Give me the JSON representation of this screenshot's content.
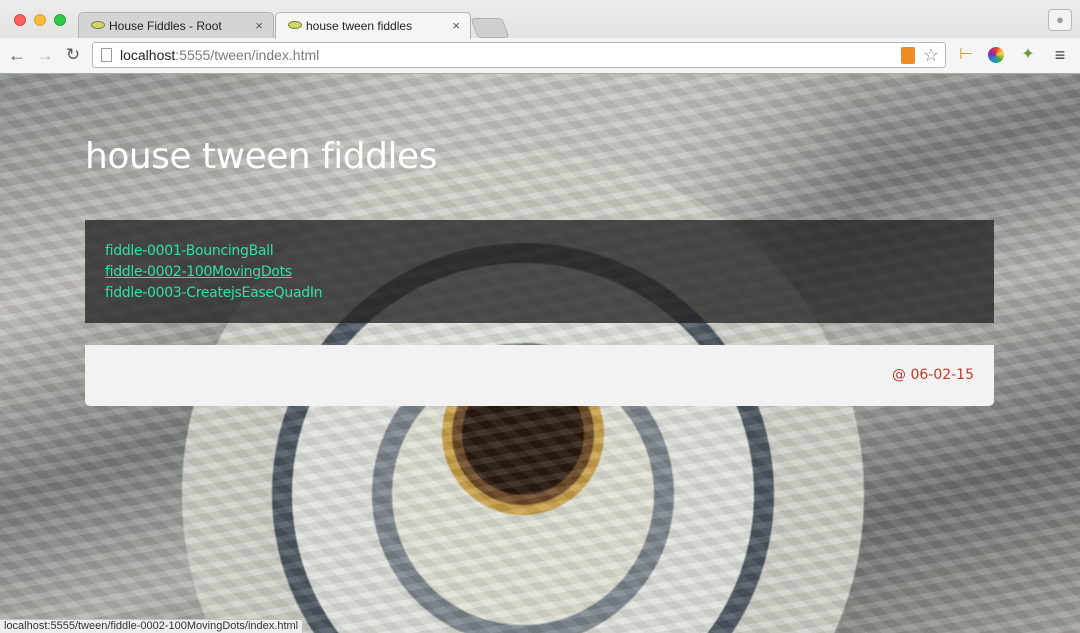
{
  "browser": {
    "tabs": [
      {
        "title": "House Fiddles - Root",
        "close": "×"
      },
      {
        "title": "house tween fiddles",
        "close": "×"
      }
    ],
    "user_icon": "person-icon",
    "nav": {
      "back": "←",
      "forward": "→",
      "reload": "↻"
    },
    "url_host": "localhost",
    "url_path": ":5555/tween/index.html",
    "star": "☆",
    "menu": "≡",
    "status_url": "localhost:5555/tween/fiddle-0002-100MovingDots/index.html"
  },
  "page": {
    "title": "house tween fiddles",
    "links": [
      "fiddle-0001-BouncingBall",
      "fiddle-0002-100MovingDots",
      "fiddle-0003-CreatejsEaseQuadIn"
    ],
    "hovered_link_index": 1,
    "footer_date": "@ 06-02-15"
  },
  "colors": {
    "link": "#2fe0a6",
    "date": "#c0392b",
    "title": "#ffffff"
  }
}
